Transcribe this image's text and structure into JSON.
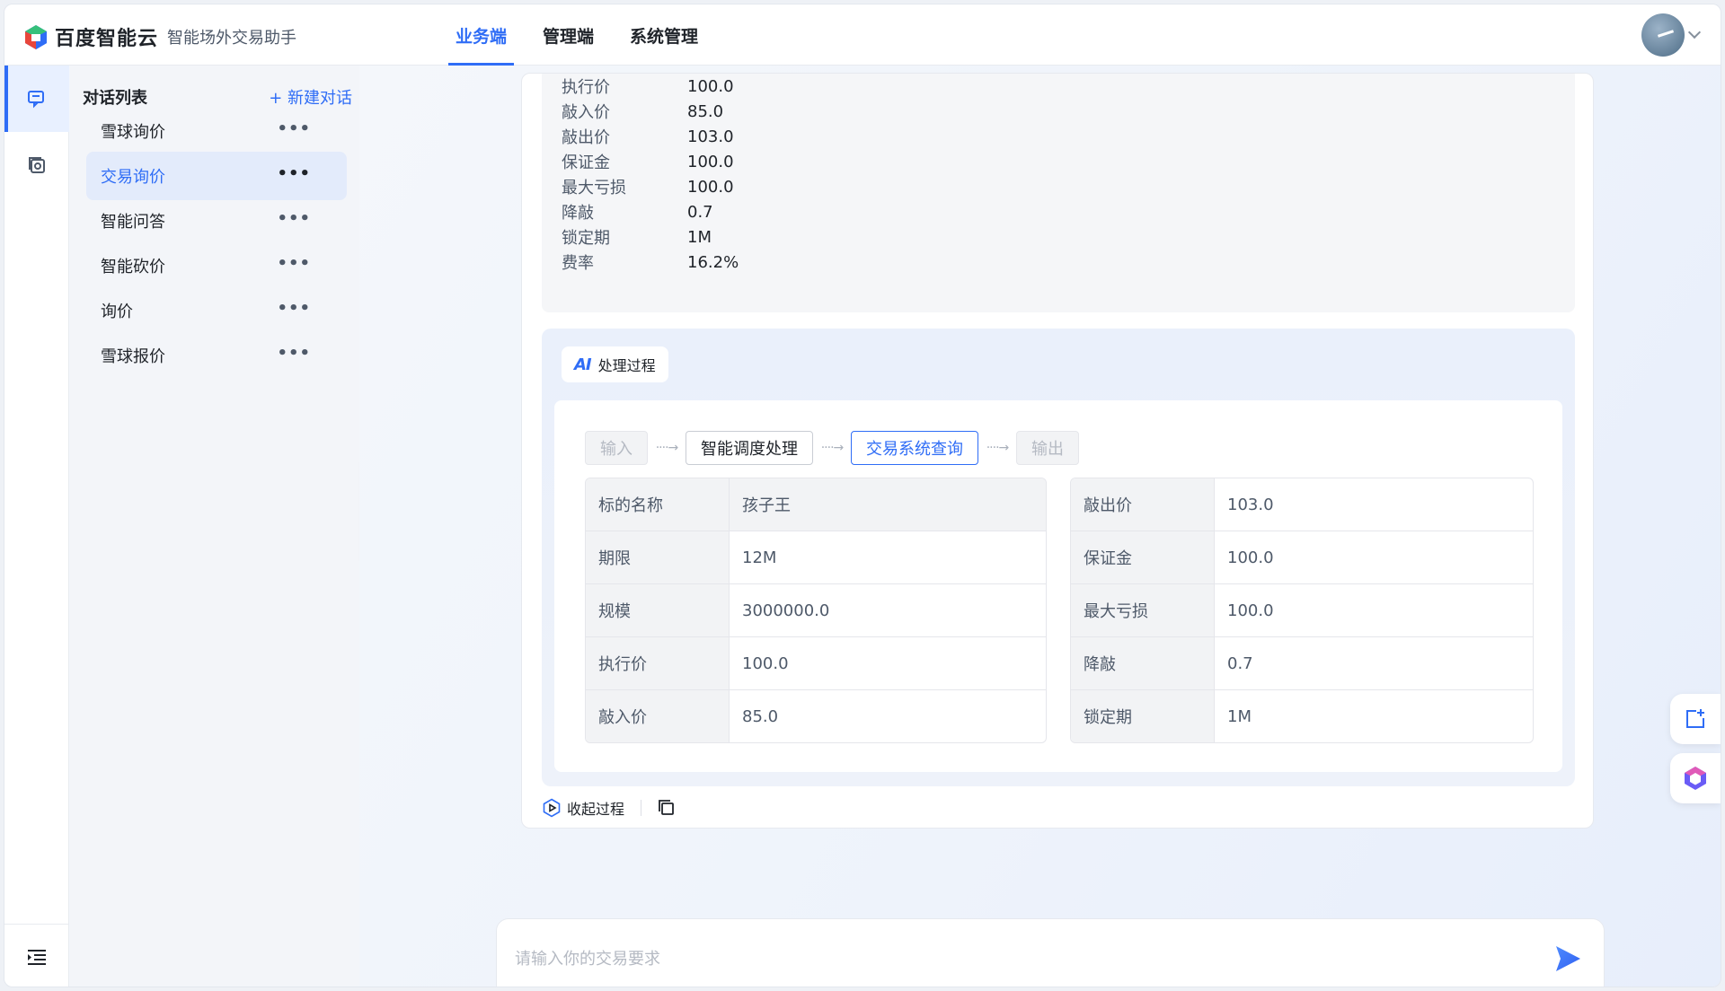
{
  "header": {
    "brand": "百度智能云",
    "product": "智能场外交易助手",
    "tabs": [
      {
        "label": "业务端",
        "active": true
      },
      {
        "label": "管理端",
        "active": false
      },
      {
        "label": "系统管理",
        "active": false
      }
    ]
  },
  "sidebar": {
    "title": "对话列表",
    "new_chat": "+ 新建对话",
    "items": [
      {
        "label": "雪球询价"
      },
      {
        "label": "交易询价"
      },
      {
        "label": "智能问答"
      },
      {
        "label": "智能砍价"
      },
      {
        "label": "询价"
      },
      {
        "label": "雪球报价"
      }
    ],
    "more": "•••"
  },
  "params": [
    {
      "k": "执行价",
      "v": "100.0"
    },
    {
      "k": "敲入价",
      "v": "85.0"
    },
    {
      "k": "敲出价",
      "v": "103.0"
    },
    {
      "k": "保证金",
      "v": "100.0"
    },
    {
      "k": "最大亏损",
      "v": "100.0"
    },
    {
      "k": "降敲",
      "v": "0.7"
    },
    {
      "k": "锁定期",
      "v": "1M"
    },
    {
      "k": "费率",
      "v": "16.2%"
    }
  ],
  "process": {
    "badge": "处理过程",
    "ai_mark": "AI",
    "steps": [
      "输入",
      "智能调度处理",
      "交易系统查询",
      "输出"
    ],
    "arrow": "····→",
    "left_table": [
      {
        "k": "标的名称",
        "v": "孩子王"
      },
      {
        "k": "期限",
        "v": "12M"
      },
      {
        "k": "规模",
        "v": "3000000.0"
      },
      {
        "k": "执行价",
        "v": "100.0"
      },
      {
        "k": "敲入价",
        "v": "85.0"
      }
    ],
    "right_table": [
      {
        "k": "敲出价",
        "v": "103.0"
      },
      {
        "k": "保证金",
        "v": "100.0"
      },
      {
        "k": "最大亏损",
        "v": "100.0"
      },
      {
        "k": "降敲",
        "v": "0.7"
      },
      {
        "k": "锁定期",
        "v": "1M"
      }
    ]
  },
  "actions": {
    "collapse": "收起过程"
  },
  "composer": {
    "placeholder": "请输入你的交易要求"
  },
  "colors": {
    "accent": "#2f6df6",
    "muted": "#4e5969"
  }
}
